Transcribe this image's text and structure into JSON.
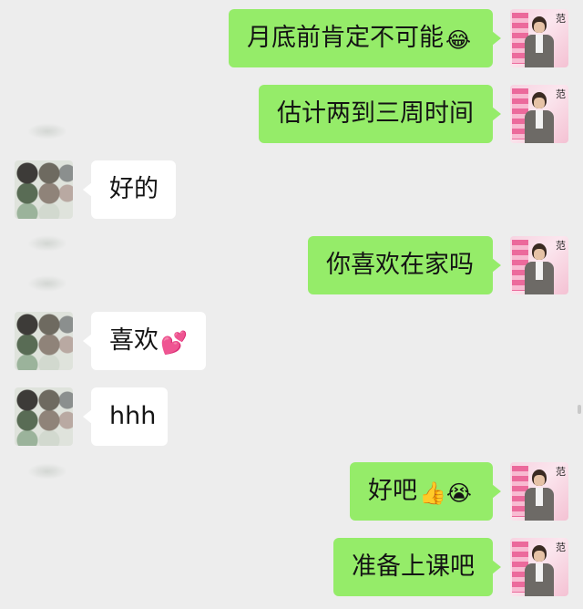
{
  "messages": [
    {
      "side": "me",
      "text": "月底前肯定不可能",
      "emoji": "😂"
    },
    {
      "side": "me",
      "text": "估计两到三周时间",
      "emoji": ""
    },
    {
      "side": "other",
      "text": "好的",
      "emoji": ""
    },
    {
      "side": "me",
      "text": "你喜欢在家吗",
      "emoji": ""
    },
    {
      "side": "other",
      "text": "喜欢",
      "emoji": "💕"
    },
    {
      "side": "other",
      "text": "hhh",
      "emoji": ""
    },
    {
      "side": "me",
      "text": "好吧",
      "emoji": "👍😭"
    },
    {
      "side": "me",
      "text": "准备上课吧",
      "emoji": ""
    }
  ],
  "avatars": {
    "me": {
      "glyph": "范"
    },
    "other": {
      "icon": "blurred-avatar-icon"
    }
  },
  "colors": {
    "background": "#ededed",
    "my_bubble": "#95ec69",
    "their_bubble": "#ffffff"
  }
}
